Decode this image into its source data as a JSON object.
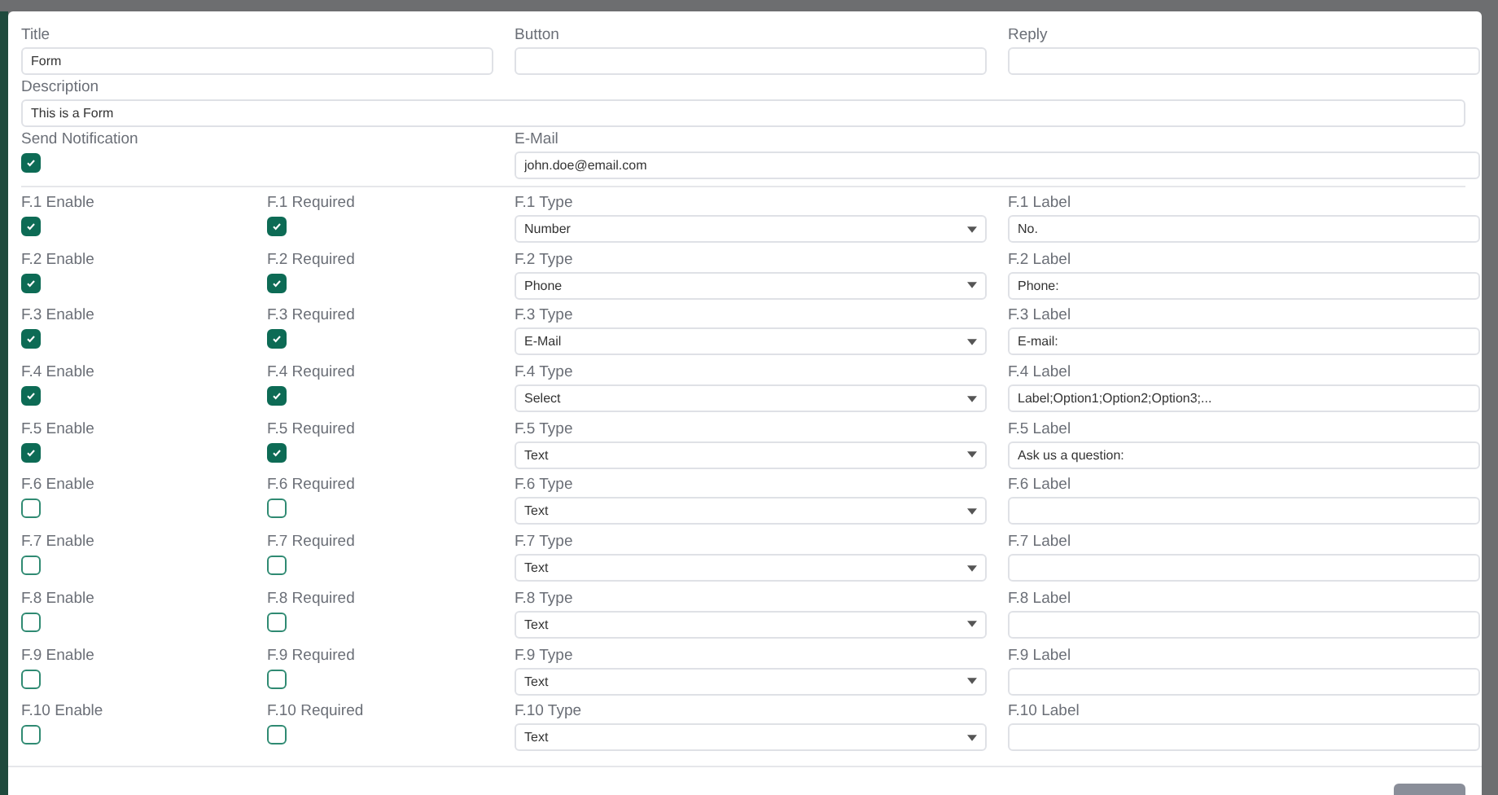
{
  "top_fields": [
    {
      "label": "Title",
      "value": "Form"
    },
    {
      "label": "Button"
    },
    {
      "label": "Reply"
    }
  ],
  "description": {
    "label": "Description",
    "value": "This is a Form"
  },
  "send_notification": {
    "label": "Send Notification",
    "checked": true
  },
  "email": {
    "label": "E-Mail",
    "value": "john.doe@email.com"
  },
  "fields": [
    {
      "enable_label": "F.1 Enable",
      "enabled": true,
      "required_label": "F.1 Required",
      "required": true,
      "type_label": "F.1 Type",
      "type": "Number",
      "label_label": "F.1 Label",
      "label": "No."
    },
    {
      "enable_label": "F.2 Enable",
      "enabled": true,
      "required_label": "F.2 Required",
      "required": true,
      "type_label": "F.2 Type",
      "type": "Phone",
      "label_label": "F.2 Label",
      "label": "Phone:"
    },
    {
      "enable_label": "F.3 Enable",
      "enabled": true,
      "required_label": "F.3 Required",
      "required": true,
      "type_label": "F.3 Type",
      "type": "E-Mail",
      "label_label": "F.3 Label",
      "label": "E-mail:"
    },
    {
      "enable_label": "F.4 Enable",
      "enabled": true,
      "required_label": "F.4 Required",
      "required": true,
      "type_label": "F.4 Type",
      "type": "Select",
      "label_label": "F.4 Label",
      "label": "Label;Option1;Option2;Option3;..."
    },
    {
      "enable_label": "F.5 Enable",
      "enabled": true,
      "required_label": "F.5 Required",
      "required": true,
      "type_label": "F.5 Type",
      "type": "Text",
      "label_label": "F.5 Label",
      "label": "Ask us a question:"
    },
    {
      "enable_label": "F.6 Enable",
      "enabled": false,
      "required_label": "F.6 Required",
      "required": false,
      "type_label": "F.6 Type",
      "type": "Text",
      "label_label": "F.6 Label"
    },
    {
      "enable_label": "F.7 Enable",
      "enabled": false,
      "required_label": "F.7 Required",
      "required": false,
      "type_label": "F.7 Type",
      "type": "Text",
      "label_label": "F.7 Label"
    },
    {
      "enable_label": "F.8 Enable",
      "enabled": false,
      "required_label": "F.8 Required",
      "required": false,
      "type_label": "F.8 Type",
      "type": "Text",
      "label_label": "F.8 Label"
    },
    {
      "enable_label": "F.9 Enable",
      "enabled": false,
      "required_label": "F.9 Required",
      "required": false,
      "type_label": "F.9 Type",
      "type": "Text",
      "label_label": "F.9 Label"
    },
    {
      "enable_label": "F.10 Enable",
      "enabled": false,
      "required_label": "F.10 Required",
      "required": false,
      "type_label": "F.10 Type",
      "type": "Text",
      "label_label": "F.10 Label"
    }
  ]
}
